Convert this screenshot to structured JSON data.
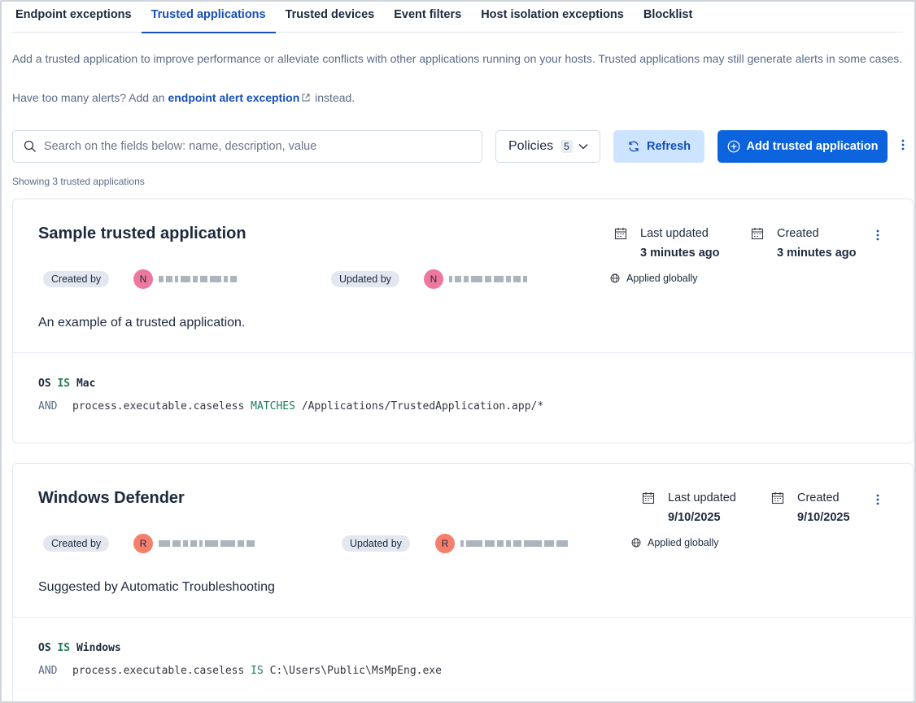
{
  "tabs": [
    {
      "label": "Endpoint exceptions",
      "active": false
    },
    {
      "label": "Trusted applications",
      "active": true
    },
    {
      "label": "Trusted devices",
      "active": false
    },
    {
      "label": "Event filters",
      "active": false
    },
    {
      "label": "Host isolation exceptions",
      "active": false
    },
    {
      "label": "Blocklist",
      "active": false
    }
  ],
  "description": "Add a trusted application to improve performance or alleviate conflicts with other applications running on your hosts. Trusted applications may still generate alerts in some cases.",
  "help": {
    "prefix": "Have too many alerts? Add an",
    "link": "endpoint alert exception",
    "suffix": "instead."
  },
  "toolbar": {
    "search_placeholder": "Search on the fields below: name, description, value",
    "search_value": "",
    "policies_label": "Policies",
    "policies_count": "5",
    "refresh_label": "Refresh",
    "add_label": "Add trusted application"
  },
  "showing": "Showing 3 trusted applications",
  "cards": [
    {
      "name": "Sample trusted application",
      "last_updated_label": "Last updated",
      "last_updated": "3 minutes ago",
      "created_label": "Created",
      "created": "3 minutes ago",
      "created_by_label": "Created by",
      "created_by_initial": "N",
      "updated_by_label": "Updated by",
      "updated_by_initial": "N",
      "scope": "Applied globally",
      "description": "An example of a trusted application.",
      "condition": {
        "os_field": "OS",
        "os_op": "IS",
        "os_value": "Mac",
        "and": "AND",
        "field": "process.executable.caseless",
        "operator": "MATCHES",
        "value": "/Applications/TrustedApplication.app/*"
      }
    },
    {
      "name": "Windows Defender",
      "last_updated_label": "Last updated",
      "last_updated": "9/10/2025",
      "created_label": "Created",
      "created": "9/10/2025",
      "created_by_label": "Created by",
      "created_by_initial": "R",
      "updated_by_label": "Updated by",
      "updated_by_initial": "R",
      "scope": "Applied globally",
      "description": "Suggested by Automatic Troubleshooting",
      "condition": {
        "os_field": "OS",
        "os_op": "IS",
        "os_value": "Windows",
        "and": "AND",
        "field": "process.executable.caseless",
        "operator": "IS",
        "value": "C:\\Users\\Public\\MsMpEng.exe"
      }
    }
  ],
  "colors": {
    "accent": "#1750ba",
    "primary_button": "#0b64dd",
    "secondary_button": "#cce4ff",
    "condition_keyword": "#1e7d59"
  }
}
